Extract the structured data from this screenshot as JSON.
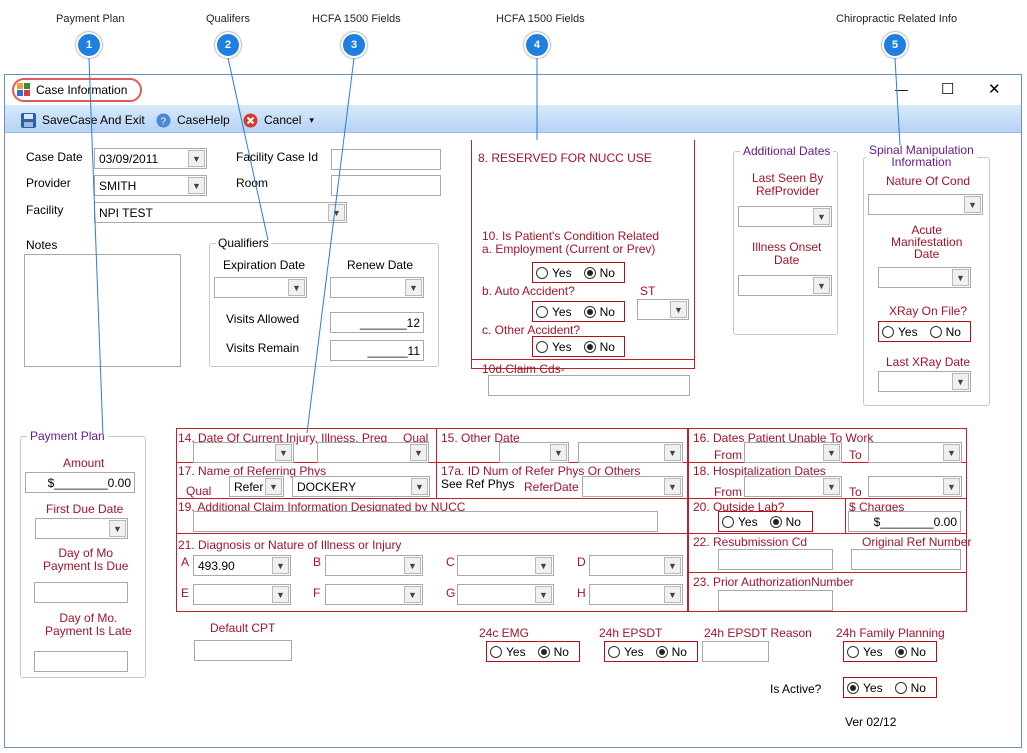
{
  "callouts": [
    {
      "label": "Payment Plan",
      "num": "1"
    },
    {
      "label": "Qualifers",
      "num": "2"
    },
    {
      "label": "HCFA 1500 Fields",
      "num": "3"
    },
    {
      "label": "HCFA 1500 Fields",
      "num": "4"
    },
    {
      "label": "Chiropractic Related Info",
      "num": "5"
    }
  ],
  "window": {
    "title": "Case Information",
    "min": "—",
    "max": "☐",
    "close": "✕"
  },
  "toolbar": {
    "save": "SaveCase And Exit",
    "help": "CaseHelp",
    "cancel": "Cancel",
    "more": "▾"
  },
  "case": {
    "date_label": "Case Date",
    "date": "03/09/2011",
    "provider_label": "Provider",
    "provider": "SMITH",
    "facility_label": "Facility",
    "facility": "NPI TEST",
    "facility_case_label": "Facility Case Id",
    "room_label": "Room",
    "notes_label": "Notes"
  },
  "qualifiers": {
    "title": "Qualifiers",
    "exp_label": "Expiration Date",
    "renew_label": "Renew Date",
    "visits_allowed_label": "Visits Allowed",
    "visits_allowed": "_______12",
    "visits_remain_label": "Visits Remain",
    "visits_remain": "______11"
  },
  "payment": {
    "title": "Payment Plan",
    "amount_label": "Amount",
    "amount": "$________0.00",
    "first_due_label": "First Due Date",
    "day_due_label": "Day of Mo\nPayment Is Due",
    "day_late_label": "Day of Mo.\nPayment Is Late"
  },
  "hcfa_top": {
    "reserved": "8. RESERVED FOR NUCC USE",
    "q10": "10. Is Patient's Condition Related",
    "q10a": "a. Employment (Current or Prev)",
    "q10b": "b. Auto Accident?",
    "st": "ST",
    "q10c": "c. Other Accident?",
    "q10d": "10d.Claim Cds-",
    "yes": "Yes",
    "no": "No"
  },
  "additional": {
    "title": "Additional Dates",
    "last_seen": "Last Seen By\nRefProvider",
    "illness": "Illness Onset\nDate"
  },
  "spinal": {
    "title": "Spinal Manipulation\nInformation",
    "nature": "Nature Of Cond",
    "acute": "Acute\nManifestation\nDate",
    "xray": "XRay On File?",
    "last_xray": "Last XRay Date",
    "yes": "Yes",
    "no": "No"
  },
  "grid": {
    "f14": "14. Date Of Current Injury, Illness, Preg",
    "qual": "Qual",
    "f15": "15. Other Date",
    "f16": "16. Dates Patient Unable To Work",
    "from": "From",
    "to": "To",
    "f17": "17. Name of Referring Phys",
    "refer": "Refer",
    "referring": "DOCKERY",
    "f17a": "17a. ID Num of Refer Phys Or Others",
    "see_ref": "See Ref Phys",
    "refer_date": "ReferDate",
    "f18": "18. Hospitalization Dates",
    "f19": "19. Additional Claim Information Designated by NUCC",
    "f20": "20. Outside Lab?",
    "charges": "$ Charges",
    "charges_val": "$________0.00",
    "f21": "21. Diagnosis or Nature of Illness or Injury",
    "diagA": "493.90",
    "f22": "22. Resubmission Cd",
    "orig_ref": "Original Ref Number",
    "f23": "23. Prior AuthorizationNumber",
    "letters": [
      "A",
      "B",
      "C",
      "D",
      "E",
      "F",
      "G",
      "H"
    ],
    "yes": "Yes",
    "no": "No"
  },
  "bottom": {
    "default_cpt": "Default CPT",
    "emg": "24c EMG",
    "epsdt": "24h EPSDT",
    "epsdt_reason": "24h EPSDT Reason",
    "family": "24h Family Planning",
    "active": "Is Active?",
    "ver": "Ver 02/12",
    "yes": "Yes",
    "no": "No"
  }
}
